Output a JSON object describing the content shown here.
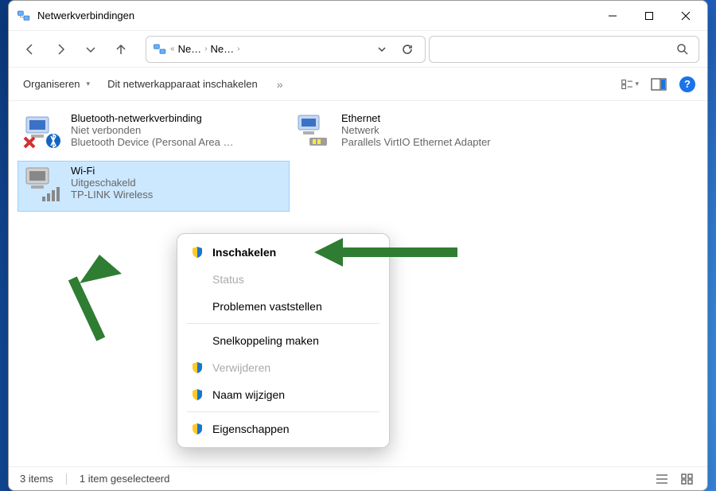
{
  "window": {
    "title": "Netwerkverbindingen"
  },
  "breadcrumb": {
    "item1": "Ne…",
    "item2": "Ne…"
  },
  "commandbar": {
    "organize": "Organiseren",
    "enable": "Dit netwerkapparaat inschakelen",
    "help_glyph": "?"
  },
  "connections": [
    {
      "name": "Bluetooth-netwerkverbinding",
      "status": "Niet verbonden",
      "device": "Bluetooth Device (Personal Area …"
    },
    {
      "name": "Ethernet",
      "status": "Netwerk",
      "device": "Parallels VirtIO Ethernet Adapter"
    },
    {
      "name": "Wi-Fi",
      "status": "Uitgeschakeld",
      "device": "TP-LINK Wireless"
    }
  ],
  "context_menu": {
    "enable": "Inschakelen",
    "status": "Status",
    "diagnose": "Problemen vaststellen",
    "shortcut": "Snelkoppeling maken",
    "delete": "Verwijderen",
    "rename": "Naam wijzigen",
    "properties": "Eigenschappen"
  },
  "statusbar": {
    "items": "3 items",
    "selected": "1 item geselecteerd"
  }
}
